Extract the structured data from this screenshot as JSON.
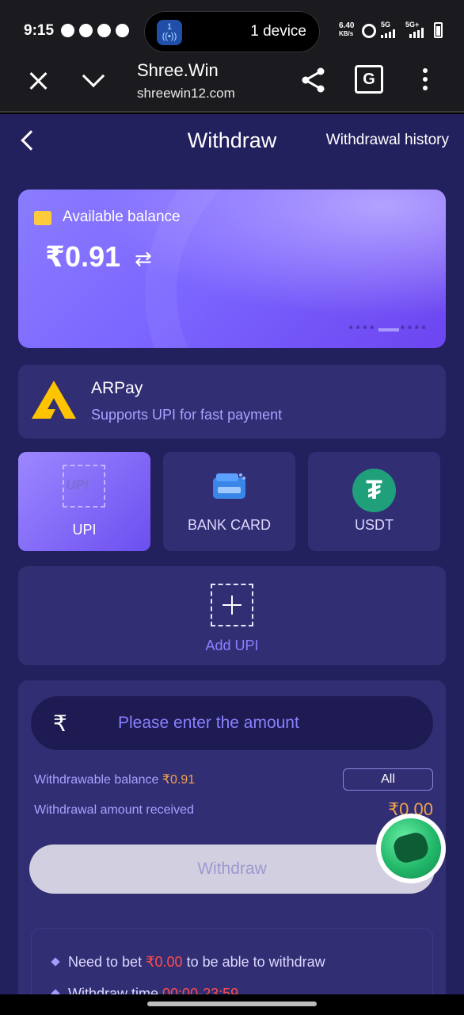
{
  "status_bar": {
    "time": "9:15",
    "pill_badge": "1",
    "pill_text": "1 device",
    "speed_value": "6.40",
    "speed_unit": "KB/s",
    "net1": "5G",
    "net2": "5G+"
  },
  "browser": {
    "title": "Shree.Win",
    "url": "shreewin12.com",
    "translate_glyph": "G"
  },
  "header": {
    "title": "Withdraw",
    "history_link": "Withdrawal history"
  },
  "balance": {
    "label": "Available balance",
    "amount": "₹0.91",
    "mask_left": "****",
    "mask_right": "****"
  },
  "channel": {
    "name": "ARPay",
    "subtitle": "Supports UPI for fast payment"
  },
  "methods": [
    {
      "label": "UPI",
      "active": true
    },
    {
      "label": "BANK CARD",
      "active": false
    },
    {
      "label": "USDT",
      "active": false
    }
  ],
  "upi_logo_text": "UPI",
  "add_upi_label": "Add UPI",
  "amount_form": {
    "currency_symbol": "₹",
    "placeholder": "Please enter the amount",
    "withdrawable_label": "Withdrawable balance",
    "withdrawable_value": "₹0.91",
    "all_button": "All",
    "received_label": "Withdrawal amount received",
    "received_value": "₹0.00",
    "submit": "Withdraw"
  },
  "rules": [
    {
      "pre": "Need to bet ",
      "highlight": "₹0.00",
      "post": " to be able to withdraw"
    },
    {
      "pre": "Withdraw time ",
      "highlight": "00:00-23:59",
      "post": ""
    }
  ],
  "colors": {
    "page_bg": "#23205e",
    "card_bg": "#322e74",
    "accent": "#7b66ff",
    "highlight_orange": "#f0a24a",
    "highlight_red": "#ff4d4d"
  }
}
